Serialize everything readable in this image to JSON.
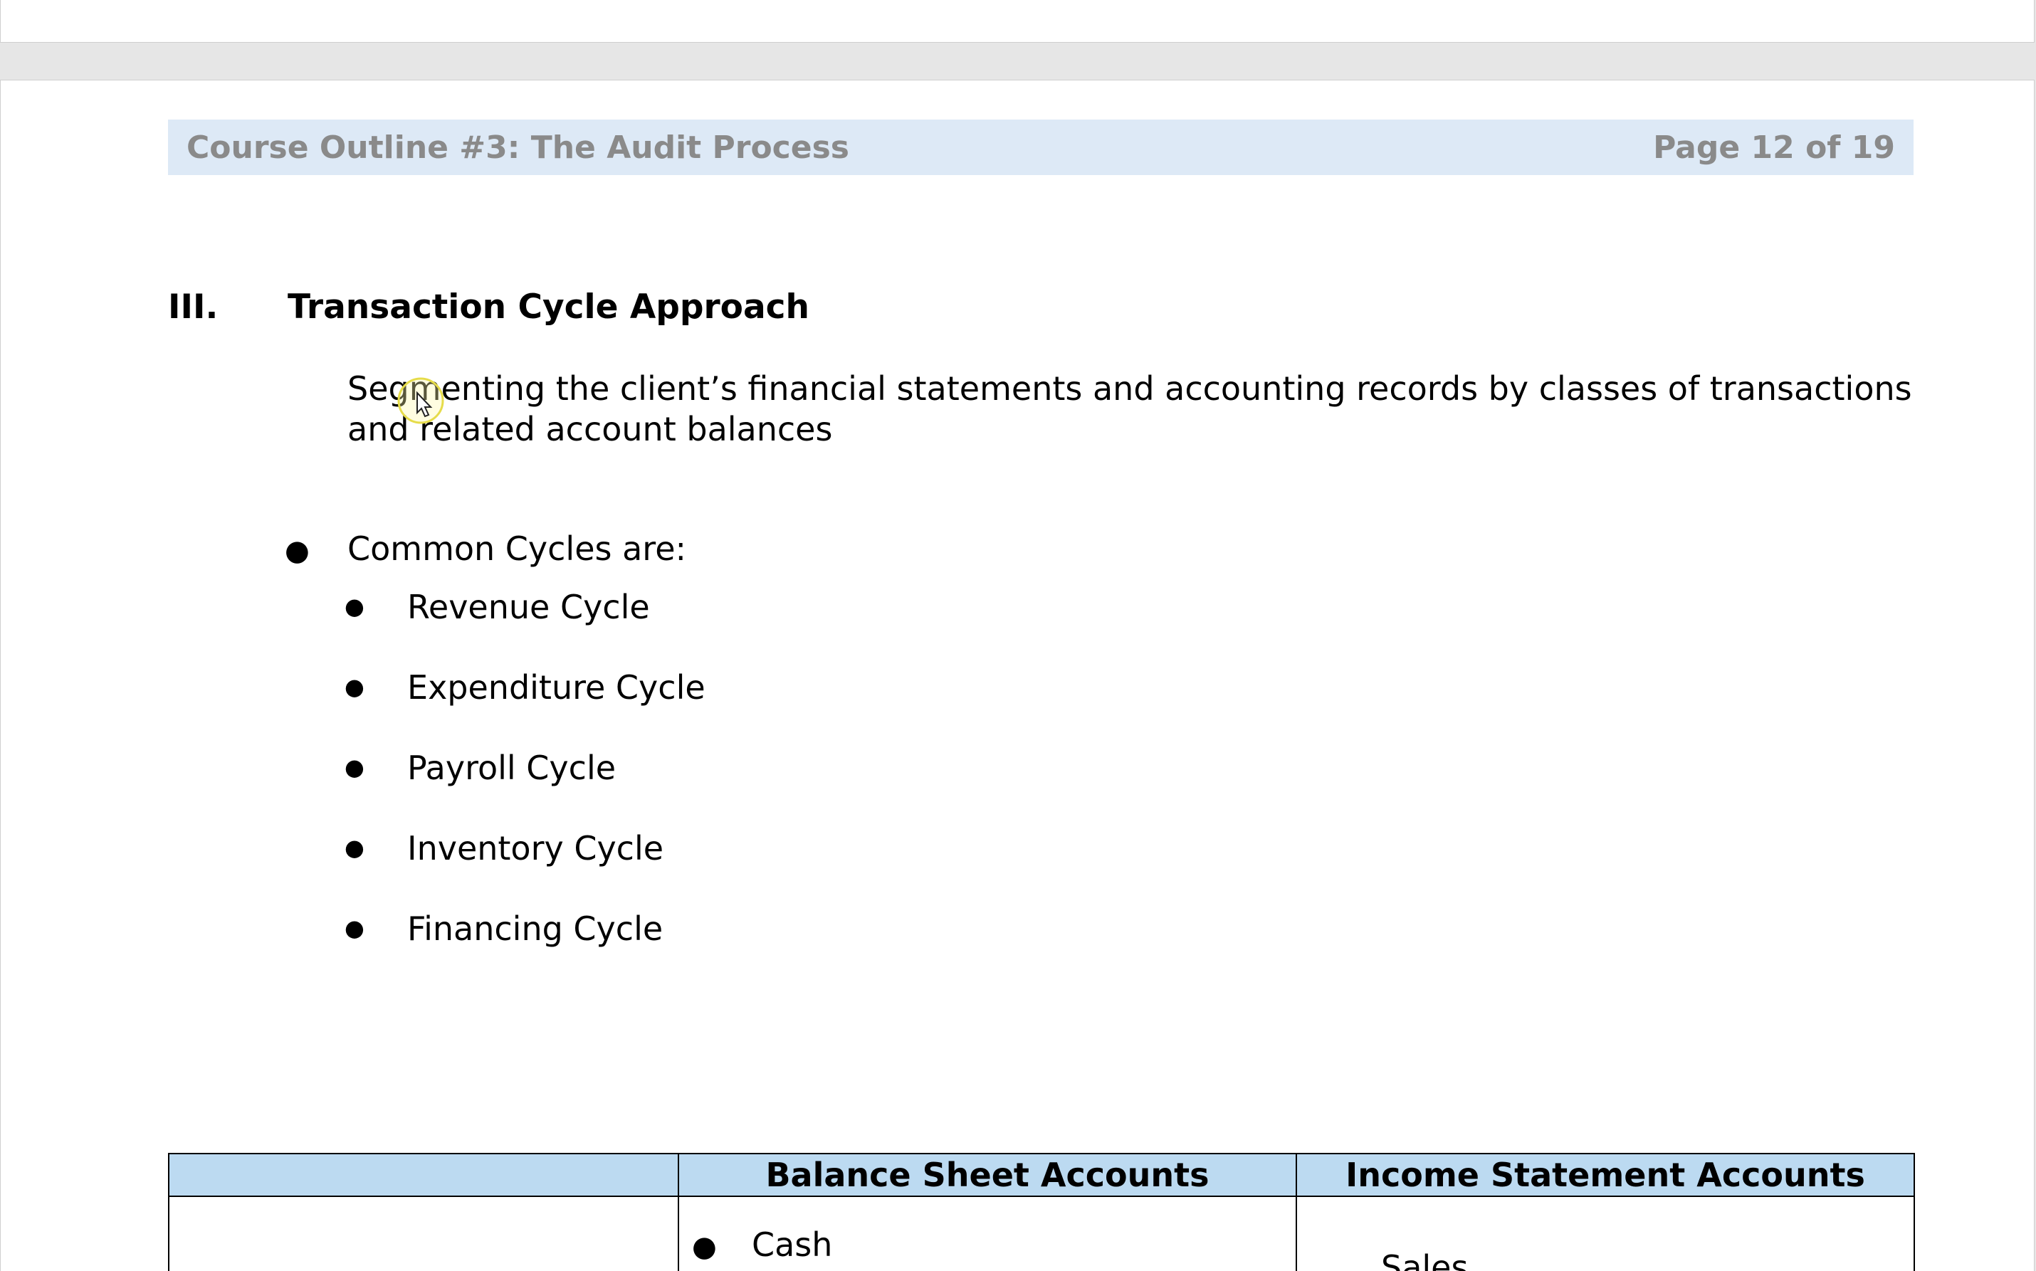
{
  "header": {
    "title": "Course Outline #3: The Audit Process",
    "page_indicator": "Page 12 of 19"
  },
  "section": {
    "number": "III.",
    "title": "Transaction Cycle Approach"
  },
  "intro_text": "Segmenting the client’s financial statements and accounting records by classes of transactions and related account balances",
  "common_cycles": {
    "label": "Common Cycles are:",
    "items": [
      "Revenue Cycle",
      "Expenditure Cycle",
      "Payroll Cycle",
      "Inventory Cycle",
      "Financing Cycle"
    ]
  },
  "table": {
    "headers": [
      "",
      "Balance Sheet Accounts",
      "Income Statement Accounts"
    ],
    "row1": {
      "balance_sheet_first": "Cash",
      "income_statement_first": "Sales"
    }
  },
  "colors": {
    "header_band": "#dde9f6",
    "table_header": "#bcdaf1",
    "header_text": "#8a8a8a"
  },
  "icons": {
    "cursor": "mouse-pointer-icon"
  }
}
